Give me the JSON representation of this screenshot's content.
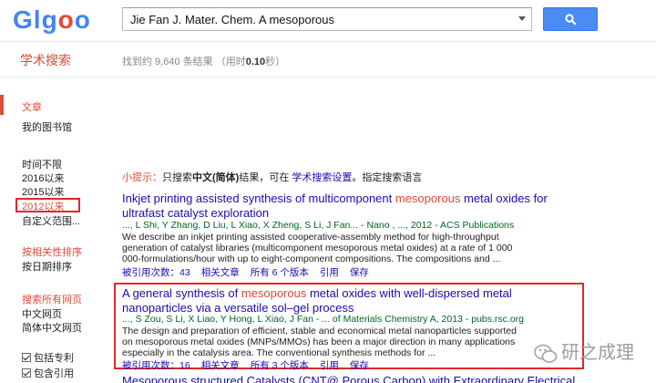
{
  "header": {
    "logo_letters": [
      {
        "ch": "G",
        "color": "#4285f4"
      },
      {
        "ch": "l",
        "color": "#4285f4"
      },
      {
        "ch": "g",
        "color": "#4285f4"
      },
      {
        "ch": "o",
        "color": "#ea4335"
      },
      {
        "ch": "o",
        "color": "#4285f4"
      }
    ],
    "search_value": "Jie Fan J. Mater. Chem. A mesoporous",
    "search_icon": "search-icon"
  },
  "brand": "学术搜索",
  "stats": {
    "prefix": "找到约 9,640 条结果  （用时",
    "time": "0.10",
    "suffix": "秒）"
  },
  "sidebar": {
    "articles": "文章",
    "library": "我的图书馆",
    "time_any": "时间不限",
    "since_2016": "2016以来",
    "since_2015": "2015以来",
    "since_2012": "2012以来",
    "custom_range": "自定义范围...",
    "sort_relevance": "按相关性排序",
    "sort_date": "按日期排序",
    "lang_all": "搜索所有网页",
    "lang_zh": "中文网页",
    "lang_zh_s": "简体中文网页",
    "include_patents": "包括专利",
    "include_citations": "包含引用"
  },
  "tip": {
    "prefix": "小提示：",
    "text1": "只搜索",
    "bold": "中文(简体)",
    "text2": "结果，可在",
    "link": "学术搜索设置",
    "text3": "指定搜索语言"
  },
  "results": [
    {
      "title_a": "Inkjet printing assisted synthesis of multicomponent ",
      "title_hl": "mesoporous",
      "title_b": " metal oxides for",
      "title_c": "ultrafast catalyst exploration",
      "meta": "..., L Shi, Y Zhang, D Liu, L Xiao, X Zheng, S Li, J Fan... - Nano , ..., 2012 - ACS Publications",
      "snippet": "We describe an inkjet printing assisted cooperative-assembly method for high-throughput generation of catalyst libraries (multicomponent mesoporous metal oxides) at a rate of 1 000 000-formulations/hour with up to eight-component compositions. The compositions and ...",
      "links": [
        "被引用次数：43",
        "相关文章",
        "所有 6 个版本",
        "引用",
        "保存"
      ]
    },
    {
      "title_a": "A general synthesis of ",
      "title_hl": "mesoporous",
      "title_b": " metal oxides with well-dispersed metal",
      "title_c": "nanoparticles via a versatile sol–gel process",
      "meta": "..., S Zou, S Li, X Liao, Y Hong, L Xiao, J Fan - ... of Materials Chemistry A, 2013 - pubs.rsc.org",
      "snippet": "The design and preparation of efficient, stable and economical metal nanoparticles supported on mesoporous metal oxides (MNPs/MMOs) has been a major direction in many applications especially in the catalysis area. The conventional synthesis methods for ...",
      "links": [
        "被引用次数：16",
        "相关文章",
        "所有 3 个版本",
        "引用",
        "保存"
      ]
    }
  ],
  "cutoff_text": "Mesoporous structured  Catalysts (CNT@ Porous Carbon) with Extraordinary Electrical",
  "watermark": "研之成理"
}
